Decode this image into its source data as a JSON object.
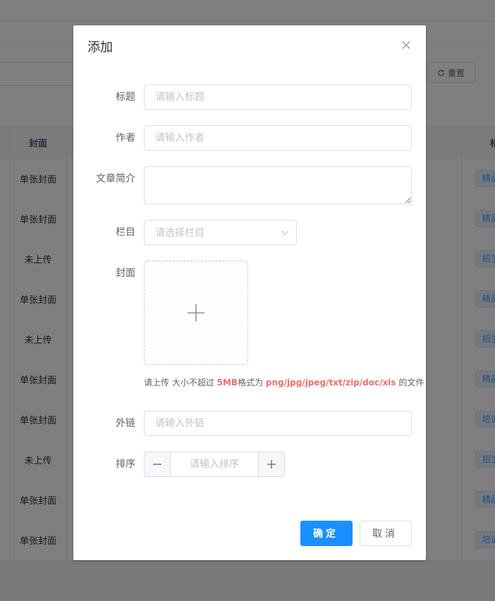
{
  "background": {
    "reset_button": "重置",
    "table_header_cover": "封面",
    "table_header_right": "标",
    "rows": [
      {
        "cover": "单张封面",
        "tag": "精品"
      },
      {
        "cover": "单张封面",
        "tag": "精品"
      },
      {
        "cover": "未上传",
        "tag": "招生"
      },
      {
        "cover": "单张封面",
        "tag": "精品"
      },
      {
        "cover": "未上传",
        "tag": "招生"
      },
      {
        "cover": "单张封面",
        "tag": "精品"
      },
      {
        "cover": "单张封面",
        "tag": "培训"
      },
      {
        "cover": "未上传",
        "tag": "招生"
      },
      {
        "cover": "单张封面",
        "tag": "精品"
      },
      {
        "cover": "单张封面",
        "tag": "培训"
      }
    ]
  },
  "dialog": {
    "title": "添加",
    "close_icon": "close-icon",
    "fields": {
      "title": {
        "label": "标题",
        "placeholder": "请输入标题",
        "value": ""
      },
      "author": {
        "label": "作者",
        "placeholder": "请输入作者",
        "value": ""
      },
      "summary": {
        "label": "文章简介",
        "value": ""
      },
      "column": {
        "label": "栏目",
        "placeholder": "请选择栏目"
      },
      "cover": {
        "label": "封面",
        "upload_icon": "plus-icon"
      },
      "link": {
        "label": "外链",
        "placeholder": "请输入外链",
        "value": ""
      },
      "order": {
        "label": "排序",
        "placeholder": "请输入排序"
      }
    },
    "upload_tip": {
      "prefix": "请上传 大小不超过 ",
      "size": "5MB",
      "middle": "格式为 ",
      "formats": "png/jpg/jpeg/txt/zip/doc/xls",
      "suffix": " 的文件"
    },
    "ok_button": "确定",
    "cancel_button": "取消"
  },
  "colors": {
    "primary": "#1890ff",
    "danger": "#f56c6c",
    "overlay": "rgba(0,0,0,0.5)"
  }
}
